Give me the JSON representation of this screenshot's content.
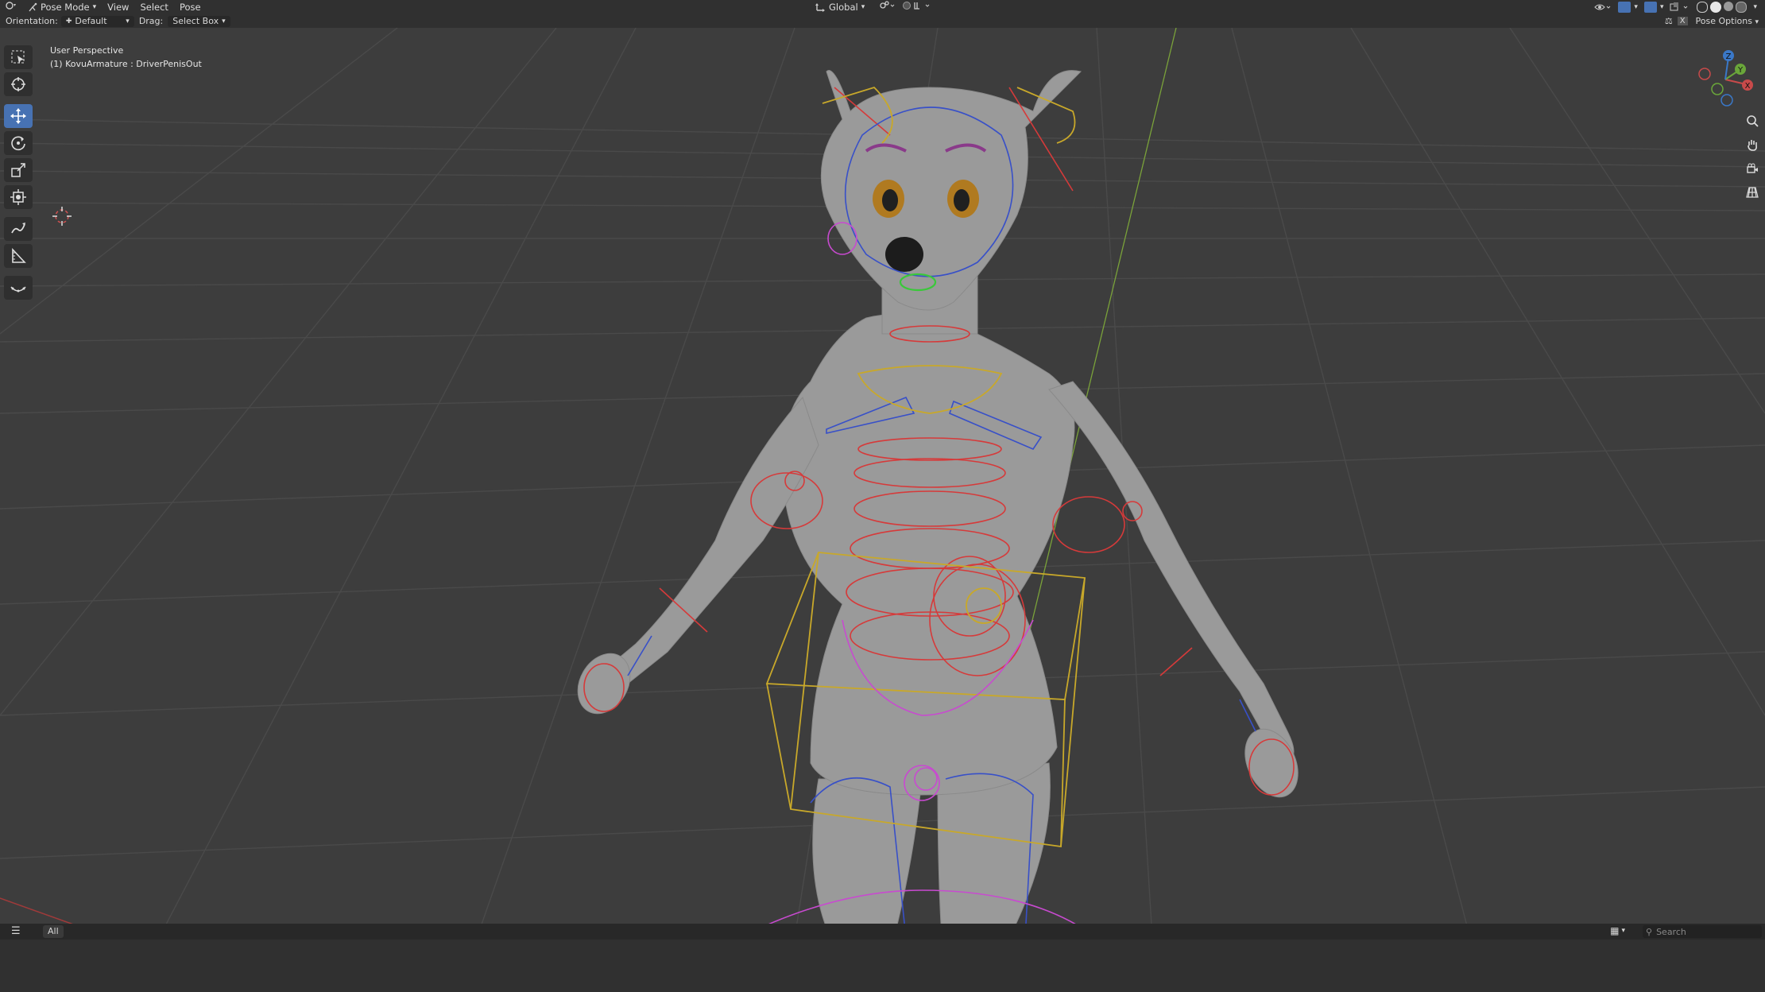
{
  "header": {
    "editor_icon": "view3d-icon",
    "mode": "Pose Mode",
    "menus": [
      "View",
      "Select",
      "Pose"
    ],
    "transform_orientation": "Global",
    "pose_options": "Pose Options"
  },
  "tool_header": {
    "orientation_label": "Orientation:",
    "orientation_value": "Default",
    "drag_label": "Drag:",
    "drag_value": "Select Box"
  },
  "viewport": {
    "perspective_label": "User Perspective",
    "object_label": "(1) KovuArmature : DriverPenisOut",
    "gizmo_axes": [
      "X",
      "Y",
      "Z"
    ]
  },
  "toolbar_tools": [
    {
      "icon": "select-box-icon",
      "active": false
    },
    {
      "icon": "cursor-icon",
      "active": false
    },
    {
      "icon": "move-icon",
      "active": true
    },
    {
      "icon": "rotate-icon",
      "active": false
    },
    {
      "icon": "scale-icon",
      "active": false
    },
    {
      "icon": "transform-icon",
      "active": false
    },
    {
      "icon": "annotate-icon",
      "active": false
    },
    {
      "icon": "measure-icon",
      "active": false
    },
    {
      "icon": "relax-pose-icon",
      "active": false
    }
  ],
  "bottom": {
    "filter_all": "All",
    "search_placeholder": "Search"
  },
  "colors": {
    "accent": "#4772b3",
    "bone_red": "#d63a3a",
    "bone_blue": "#3850c8",
    "bone_yellow": "#c8a82a",
    "bone_magenta": "#c84ad0",
    "bone_green": "#3ac83a"
  }
}
